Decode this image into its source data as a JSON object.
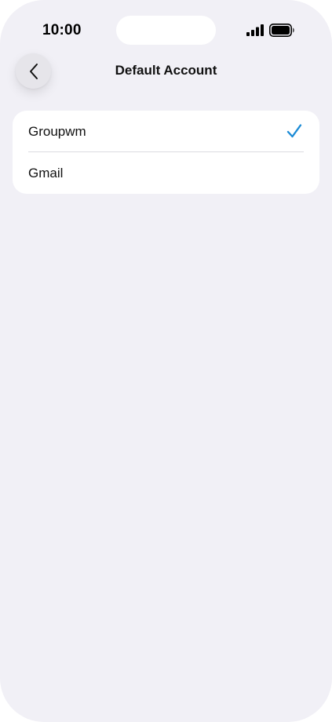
{
  "status_bar": {
    "time": "10:00",
    "icons": [
      "signal-icon",
      "battery-icon"
    ]
  },
  "nav": {
    "back_icon": "chevron-left-icon",
    "title": "Default Account"
  },
  "accounts": {
    "items": [
      {
        "label": "Groupwm",
        "selected": true
      },
      {
        "label": "Gmail",
        "selected": false
      }
    ],
    "check_icon": "checkmark-icon"
  },
  "colors": {
    "background": "#f1f0f6",
    "card": "#ffffff",
    "accent": "#1b8bd6"
  }
}
